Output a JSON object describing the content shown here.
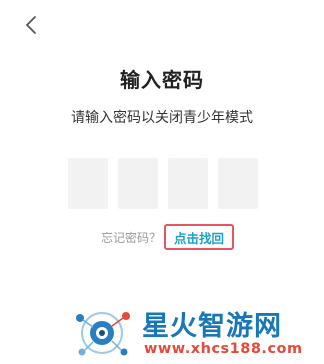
{
  "header": {
    "back_icon": "chevron-left-icon"
  },
  "main": {
    "title": "输入密码",
    "subtitle": "请输入密码以关闭青少年模式",
    "pin_length": 4,
    "forgot_label": "忘记密码？",
    "recover_link": "点击找回"
  },
  "watermark": {
    "brand": "星火智游网",
    "url": "www.xhcs188.com"
  },
  "colors": {
    "link": "#1aa3c7",
    "highlight": "#e8545e",
    "pin_box": "#f2f2f2",
    "watermark_brand": "#1877b8",
    "watermark_url": "#e64a3c"
  }
}
